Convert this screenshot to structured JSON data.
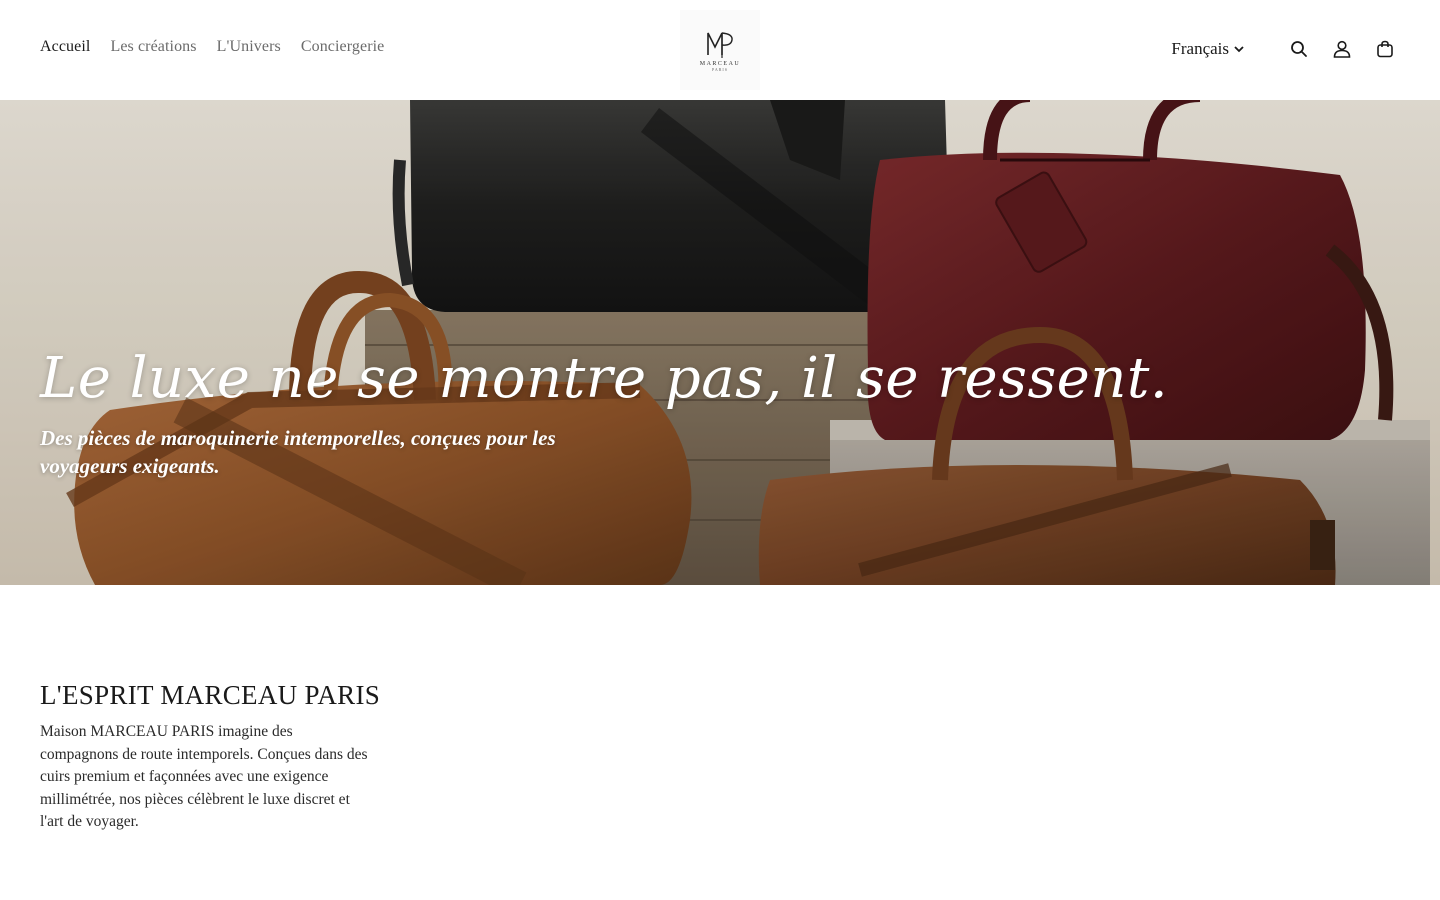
{
  "header": {
    "nav": [
      {
        "label": "Accueil",
        "active": true
      },
      {
        "label": "Les créations",
        "active": false
      },
      {
        "label": "L'Univers",
        "active": false
      },
      {
        "label": "Conciergerie",
        "active": false
      }
    ],
    "logo": {
      "monogram": "MP",
      "brand": "MARCEAU",
      "sub": "PARIS"
    },
    "language": "Français",
    "icons": [
      "search-icon",
      "account-icon",
      "cart-icon"
    ]
  },
  "hero": {
    "title": "Le luxe ne se montre pas, il se ressent.",
    "subtitle": "Des pièces de maroquinerie intemporelles, conçues pour les voyageurs exigeants."
  },
  "esprit": {
    "heading": "L'ESPRIT MARCEAU PARIS",
    "body": "Maison MARCEAU PARIS imagine des compagnons de route intemporels. Conçues dans des cuirs premium et façonnées avec une exigence millimétrée, nos pièces célèbrent le luxe discret et l'art de voyager."
  },
  "colors": {
    "text": "#1a1a1a",
    "muted": "#6b6b6b",
    "background": "#ffffff"
  }
}
